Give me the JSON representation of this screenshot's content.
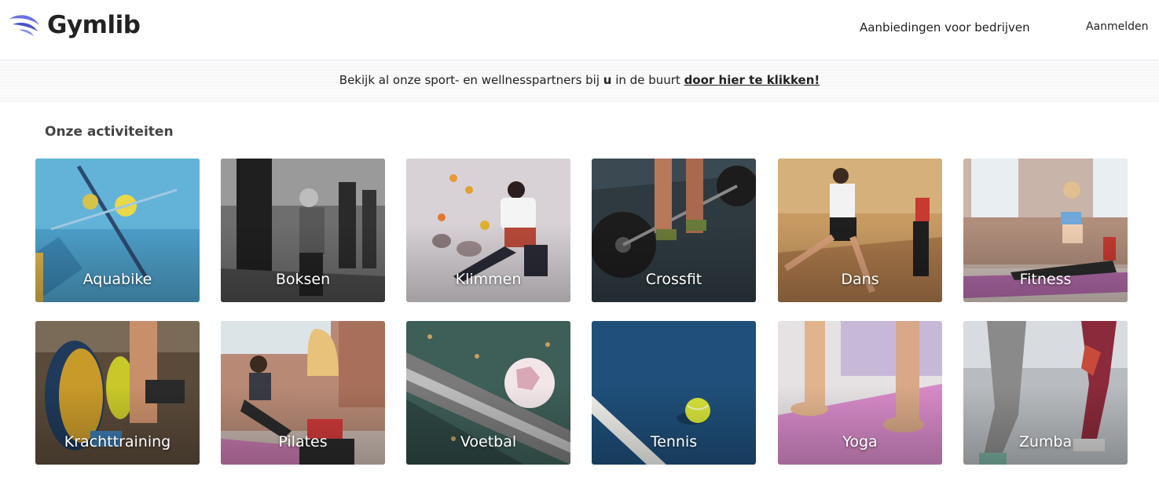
{
  "header": {
    "brand": "Gymlib",
    "nav_business": "Aanbiedingen voor bedrijven",
    "nav_login": "Aanmelden"
  },
  "banner": {
    "text_before": "Bekijk al onze sport- en wellnesspartners bij ",
    "text_emph": "u",
    "text_middle": " in de buurt ",
    "link": "door hier te klikken!"
  },
  "section": {
    "title": "Onze activiteiten"
  },
  "activities": [
    {
      "label": "Aquabike"
    },
    {
      "label": "Boksen"
    },
    {
      "label": "Klimmen"
    },
    {
      "label": "Crossfit"
    },
    {
      "label": "Dans"
    },
    {
      "label": "Fitness"
    },
    {
      "label": "Krachttraining"
    },
    {
      "label": "Pilates"
    },
    {
      "label": "Voetbal"
    },
    {
      "label": "Tennis"
    },
    {
      "label": "Yoga"
    },
    {
      "label": "Zumba"
    }
  ],
  "colors": {
    "brand_icon": "#5b5fd6",
    "text": "#222222"
  }
}
